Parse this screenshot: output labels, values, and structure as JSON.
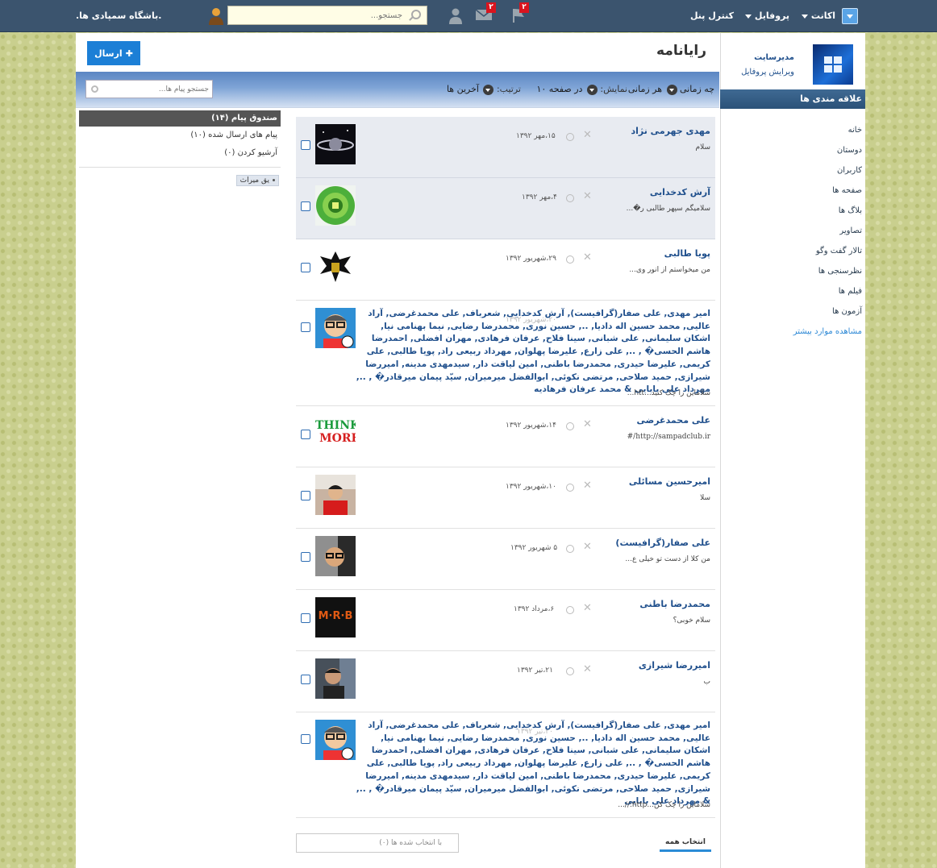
{
  "topbar": {
    "menu_accounts": "اکانت",
    "menu_profile": "پروفایل",
    "menu_control_panel": "کنترل پنل",
    "messages_badge": "۲",
    "notifications_badge": "۲",
    "search_placeholder": "جستجو...",
    "site_name": ".باشگاه سمپادی ها."
  },
  "sidebar": {
    "admin_name": "مدیرسایت",
    "edit_profile": "ویرایش پروفایل",
    "favorites_title": "علاقه مندی ها",
    "items": [
      {
        "label": "خانه"
      },
      {
        "label": "دوستان"
      },
      {
        "label": "کاربران"
      },
      {
        "label": "صفحه ها"
      },
      {
        "label": "بلاگ ها"
      },
      {
        "label": "تصاویر"
      },
      {
        "label": "تالار گفت وگو"
      },
      {
        "label": "نظرسنجی ها"
      },
      {
        "label": "فیلم ها"
      },
      {
        "label": "آزمون ها"
      },
      {
        "label": "مشاهده موارد بیشتر"
      }
    ]
  },
  "main": {
    "title": "رایانامه",
    "send_button": "ارسال",
    "filters": {
      "when_label": "چه زمانی",
      "when_value": "هر زمانی",
      "show_label": "نمایش:",
      "show_value": "در صفحه ۱۰",
      "sort_label": "ترتیب:",
      "sort_value": "آخرین ها"
    },
    "search_placeholder": "جستجو پیام ها..."
  },
  "folders": {
    "inbox": "صندوق پیام (۱۴)",
    "sent": "پیام های ارسال شده (۱۰)",
    "archive": "آرشیو کردن (۰)",
    "tag": "یق میراث"
  },
  "messages": [
    {
      "name": "مهدی جهرمی نژاد",
      "snippet": "سلام",
      "date": "۱۵،مهر ۱۳۹۲",
      "unread": true
    },
    {
      "name": "آرش کدخدایی",
      "snippet": "سلامیگم سپهر طالبی ر�...",
      "date": "۴،مهر ۱۳۹۲",
      "unread": true
    },
    {
      "name": "پویا طالبی",
      "snippet": "من میخواستم از انور وی...",
      "date": "۲۹،شهریور ۱۳۹۲"
    },
    {
      "recipients": "امیر مهدی, علی صفار(گرافیست), آرش کدخدایی, شعرباف, علی محمدغرضی, آراد عالیی, محمد حسین اله دادیا, .., حسین نوری, محمدرضا رضایی, نیما بهنامی نیا, اشکان سلیمانی, علی شبانی, سینا فلاح, عرفان فرهادی, مهران افضلی, احمدرضا هاشم الحسی� , .., علی زارع, علیرضا پهلوان, مهرداد ربیعی راد, پویا طالبی, علی کریمی, علیرضا حیدری, محمدرضا باطنی, امین لیاقت دار, سیدمهدی مدینه, امیررضا شیرازی, حمید صلاحی, مرتضی نکوئی, ابوالفضل میرمیران, سیّد پیمان میرقادر� , .., مهرداد علی بابایی & محمد عرفان فرهادیه",
      "snippet": "سلاماین را چک کنید...htt...",
      "date": "۲۰،شهریور ۱۳۹۲",
      "tall": true
    },
    {
      "name": "علی محمدغرضی",
      "snippet": "http://sampadclub.ir/#",
      "date": "۱۴،شهریور ۱۳۹۲",
      "avatar_text_1": "THINK",
      "avatar_text_2": "MORE"
    },
    {
      "name": "امیرحسین مسائلی",
      "snippet": "سلا",
      "date": "۱۰،شهریور ۱۳۹۲"
    },
    {
      "name": "علی صفار(گرافیست)",
      "snippet": "من کلا از دست تو خیلی ع...",
      "date": "۵ شهریور ۱۳۹۲"
    },
    {
      "name": "محمدرضا باطنی",
      "snippet": "سلام خوبی؟",
      "date": "۶،مرداد ۱۳۹۲",
      "avatar_text_1": "M·R·B"
    },
    {
      "name": "امیررضا شیرازی",
      "snippet": "ب",
      "date": "۲۱،تیر ۱۳۹۲"
    },
    {
      "recipients": "امیر مهدی, علی صفار(گرافیست), آرش کدخدایی, شعرباف, علی محمدغرضی, آراد عالیی, محمد حسین اله دادیا, .., حسین نوری, محمدرضا رضایی, نیما بهنامی نیا, اشکان سلیمانی, علی شبانی, سینا فلاح, عرفان فرهادی, مهران افضلی, احمدرضا هاشم الحسی� , .., علی زارع, علیرضا پهلوان, مهرداد ربیعی راد, پویا طالبی, علی کریمی, علیرضا حیدری, محمدرضا باطنی, امین لیاقت دار, سیدمهدی مدینه, امیررضا شیرازی, حمید صلاحی, مرتضی نکوئی, ابوالفضل میرمیران, سیّد پیمان میرقادر� , .., & مهرداد علی بابایی",
      "snippet": "سلاماین را چک کن...http://...",
      "date": "۲۰،تیر ۱۳۹۲",
      "tall": true
    }
  ],
  "footer": {
    "selected_box": "با انتخاب شده ها (۰)",
    "select_all": "انتخاب همه"
  },
  "colors": {
    "topbar": "#3b546e",
    "accent": "#1c7fd6",
    "badge": "#d9141e",
    "link": "#1f4f8c"
  }
}
